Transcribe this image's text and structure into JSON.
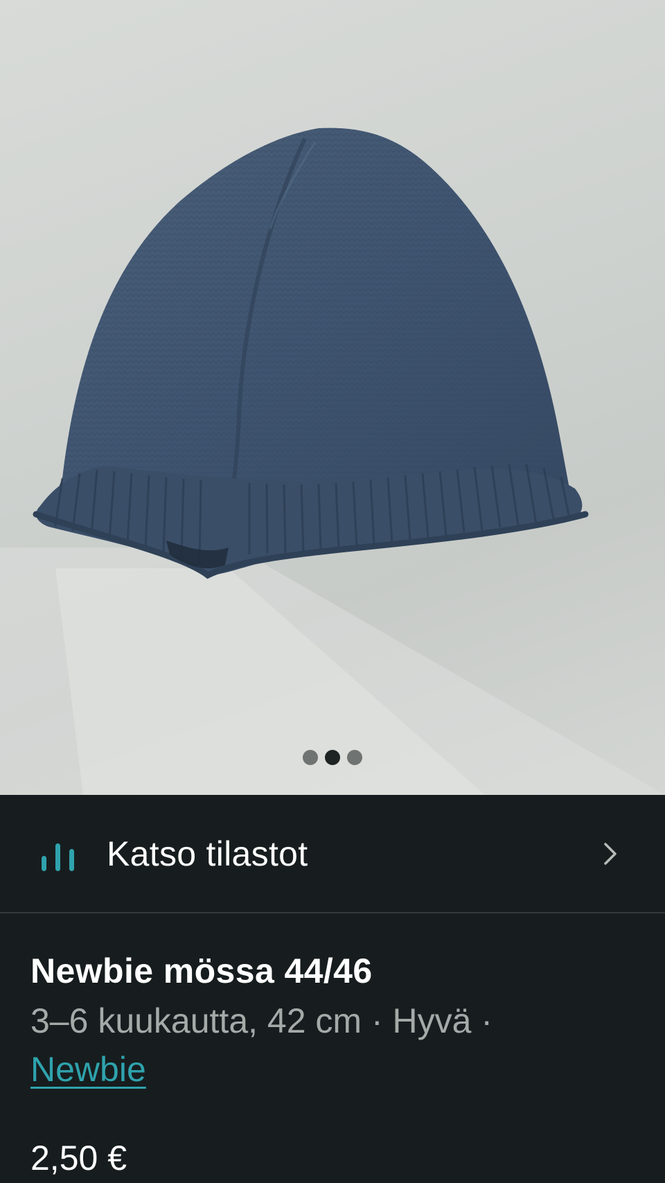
{
  "photo": {
    "subject": "hat-photo",
    "current_index": 2,
    "total": 3
  },
  "stats": {
    "label": "Katso tilastot",
    "icon": "bar-chart-icon",
    "chevron": "chevron-right-icon"
  },
  "item": {
    "title": "Newbie mössa 44/46",
    "meta": "3–6 kuukautta, 42 cm · Hyvä ·",
    "brand": "Newbie",
    "price": "2,50 €"
  },
  "colors": {
    "accent": "#2fa3ad",
    "background": "#171d1e",
    "text": "#ffffff",
    "muted": "#a5aaa9"
  }
}
